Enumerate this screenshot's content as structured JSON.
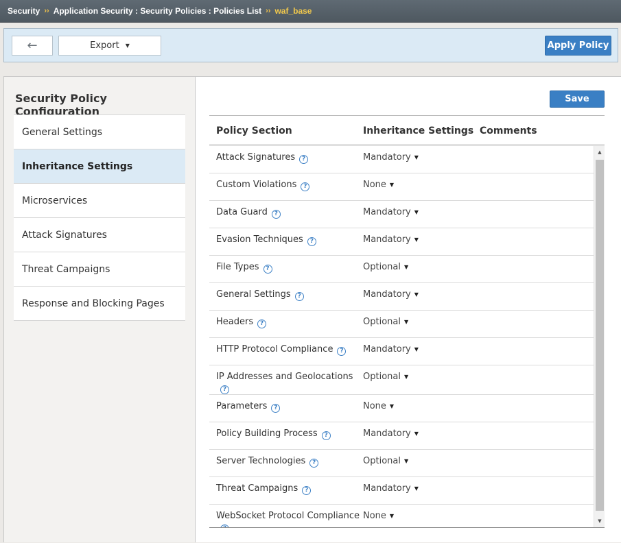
{
  "breadcrumb": {
    "items": [
      "Security",
      "Application Security : Security Policies : Policies List"
    ],
    "separator": "››",
    "current": "waf_base"
  },
  "toolbar": {
    "back_icon": "←",
    "export_label": "Export",
    "apply_label": "Apply Policy"
  },
  "sidebar": {
    "title": "Security Policy Configuration",
    "items": [
      {
        "label": "General Settings",
        "active": false
      },
      {
        "label": "Inheritance Settings",
        "active": true
      },
      {
        "label": "Microservices",
        "active": false
      },
      {
        "label": "Attack Signatures",
        "active": false
      },
      {
        "label": "Threat Campaigns",
        "active": false
      },
      {
        "label": "Response and Blocking Pages",
        "active": false
      }
    ]
  },
  "main": {
    "save_label": "Save",
    "columns": [
      "Policy Section",
      "Inheritance Settings",
      "Comments"
    ],
    "rows": [
      {
        "section": "Attack Signatures",
        "inheritance": "Mandatory"
      },
      {
        "section": "Custom Violations",
        "inheritance": "None"
      },
      {
        "section": "Data Guard",
        "inheritance": "Mandatory"
      },
      {
        "section": "Evasion Techniques",
        "inheritance": "Mandatory"
      },
      {
        "section": "File Types",
        "inheritance": "Optional"
      },
      {
        "section": "General Settings",
        "inheritance": "Mandatory"
      },
      {
        "section": "Headers",
        "inheritance": "Optional"
      },
      {
        "section": "HTTP Protocol Compliance",
        "inheritance": "Mandatory"
      },
      {
        "section": "IP Addresses and Geolocations",
        "inheritance": "Optional"
      },
      {
        "section": "Parameters",
        "inheritance": "None"
      },
      {
        "section": "Policy Building Process",
        "inheritance": "Mandatory"
      },
      {
        "section": "Server Technologies",
        "inheritance": "Optional"
      },
      {
        "section": "Threat Campaigns",
        "inheritance": "Mandatory"
      },
      {
        "section": "WebSocket Protocol Compliance",
        "inheritance": "None"
      }
    ]
  },
  "colors": {
    "accent": "#3a7fc4",
    "active_bg": "#dbeaf5",
    "breadcrumb_current": "#f2c94c"
  }
}
